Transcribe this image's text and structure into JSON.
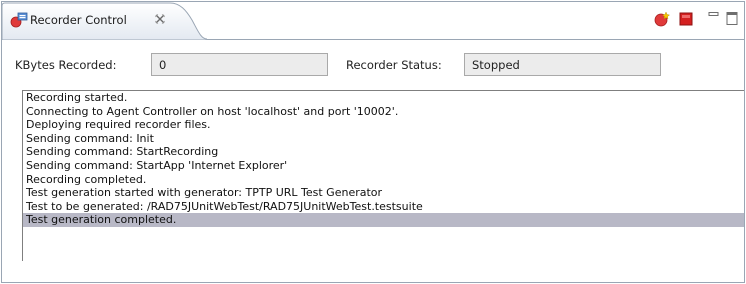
{
  "tab": {
    "title": "Recorder Control",
    "icon": "recorder-icon",
    "close_icon": "close-icon"
  },
  "toolbar": {
    "buttons": [
      "start-recording-icon",
      "stop-recording-icon",
      "minimize-icon",
      "maximize-icon"
    ]
  },
  "fields": {
    "kbytes_label": "KBytes Recorded:",
    "kbytes_value": "0",
    "status_label": "Recorder Status:",
    "status_value": "Stopped"
  },
  "log": {
    "lines": [
      "Recording started.",
      "Connecting to Agent Controller on host 'localhost' and port '10002'.",
      "Deploying required recorder files.",
      "Sending command: Init",
      "Sending command: StartRecording",
      "Sending command: StartApp 'Internet Explorer'",
      "Recording completed.",
      "Test generation started with generator: TPTP URL Test Generator",
      "Test to be generated: /RAD75JUnitWebTest/RAD75JUnitWebTest.testsuite",
      "Test generation completed."
    ],
    "selected_index": 9
  },
  "colors": {
    "selection": "#b8b8c6",
    "field_background": "#ececec",
    "record_red": "#e03a3a",
    "stop_red": "#d42020"
  }
}
